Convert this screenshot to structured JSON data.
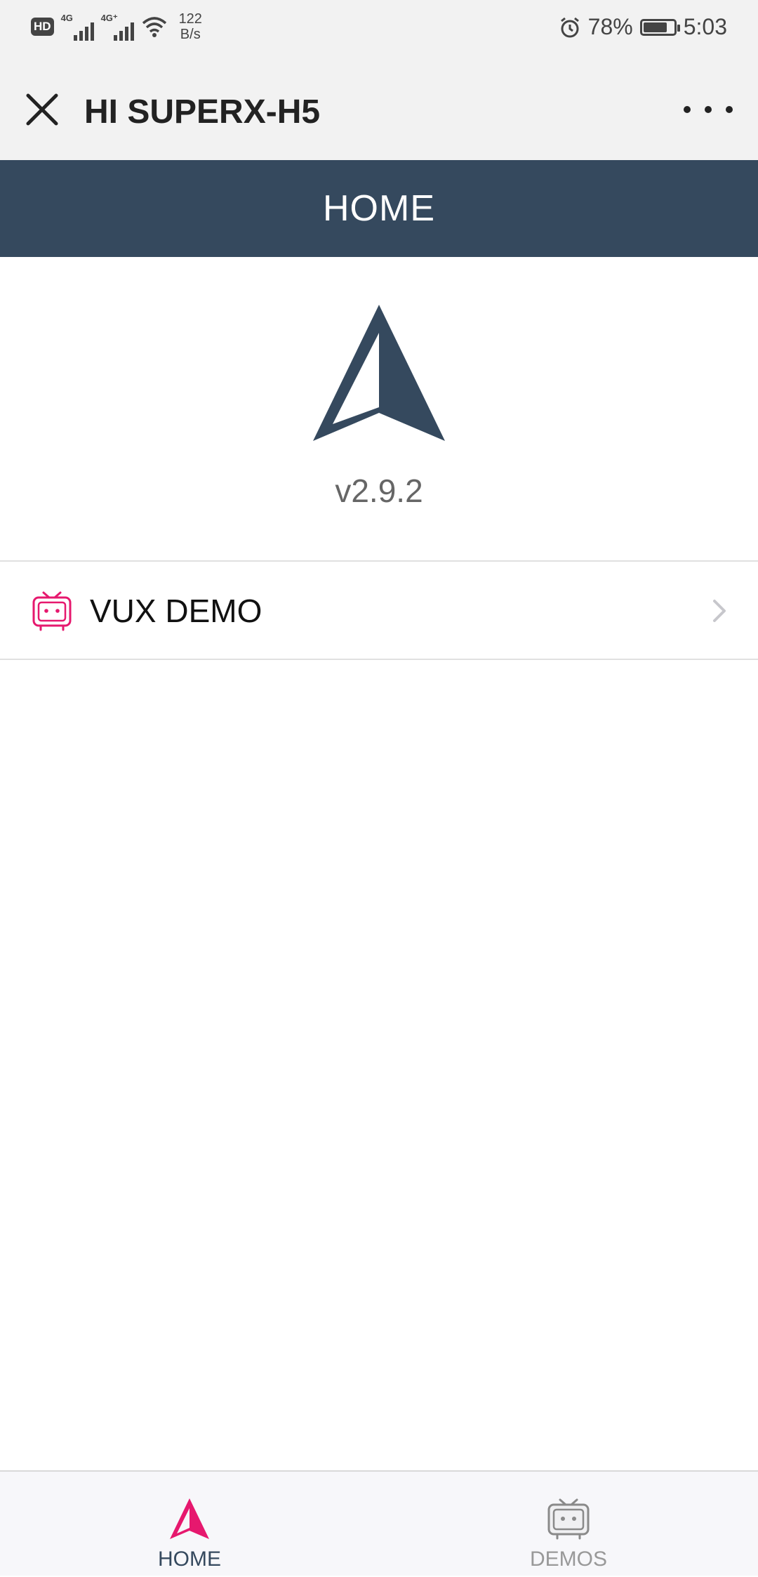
{
  "status_bar": {
    "hd_badge": "HD",
    "network1": "4G",
    "network2": "4G⁺",
    "speed_value": "122",
    "speed_unit": "B/s",
    "battery_percent": "78%",
    "battery_level": 0.78,
    "time": "5:03"
  },
  "title_bar": {
    "title": "HI SUPERX-H5"
  },
  "header": {
    "title": "HOME"
  },
  "main": {
    "version": "v2.9.2",
    "cells": [
      {
        "label": "VUX DEMO",
        "icon": "tv-robot-icon"
      }
    ]
  },
  "tabbar": {
    "tabs": [
      {
        "label": "HOME",
        "icon": "home-triangle-icon",
        "active": true
      },
      {
        "label": "DEMOS",
        "icon": "tv-robot-icon",
        "active": false
      }
    ]
  },
  "colors": {
    "header_bg": "#35495e",
    "accent_pink": "#e6186e",
    "tab_active_text": "#35495e",
    "tab_inactive": "#999999"
  }
}
